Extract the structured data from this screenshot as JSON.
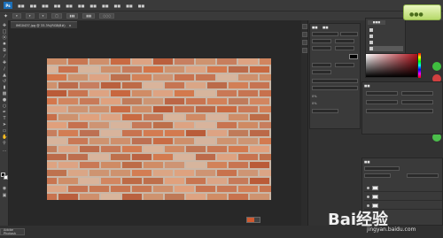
{
  "app": {
    "logo": "Ps"
  },
  "menubar": {
    "items": [
      "",
      "",
      "",
      "",
      "",
      "",
      "",
      "",
      "",
      "",
      ""
    ]
  },
  "document": {
    "tab_title": "IMG0437.jpg @ 33.3%(RGB/8#)",
    "tab_close": "×"
  },
  "tools": [
    "move",
    "marquee",
    "lasso",
    "quick-select",
    "crop",
    "eyedropper",
    "healing",
    "brush",
    "stamp",
    "history-brush",
    "eraser",
    "gradient",
    "blur",
    "dodge",
    "pen",
    "type",
    "path-select",
    "shape",
    "hand",
    "zoom"
  ],
  "colors": {
    "accent": "#1c6fb8",
    "foreground": "#000000",
    "background": "#ffffff",
    "brick": "#c8673f"
  },
  "character_panel": {
    "font_value": "",
    "size_value": "",
    "color_label": "",
    "percent_a": "0%",
    "percent_b": "0%"
  },
  "history": {
    "rows": [
      "",
      "",
      "",
      ""
    ]
  },
  "layers": {
    "rows": [
      "",
      "",
      ""
    ]
  },
  "taskbar": {
    "item": "Adobe Photosh"
  },
  "watermark": {
    "brand": "Bai经验",
    "url": "jingyan.baidu.com"
  }
}
